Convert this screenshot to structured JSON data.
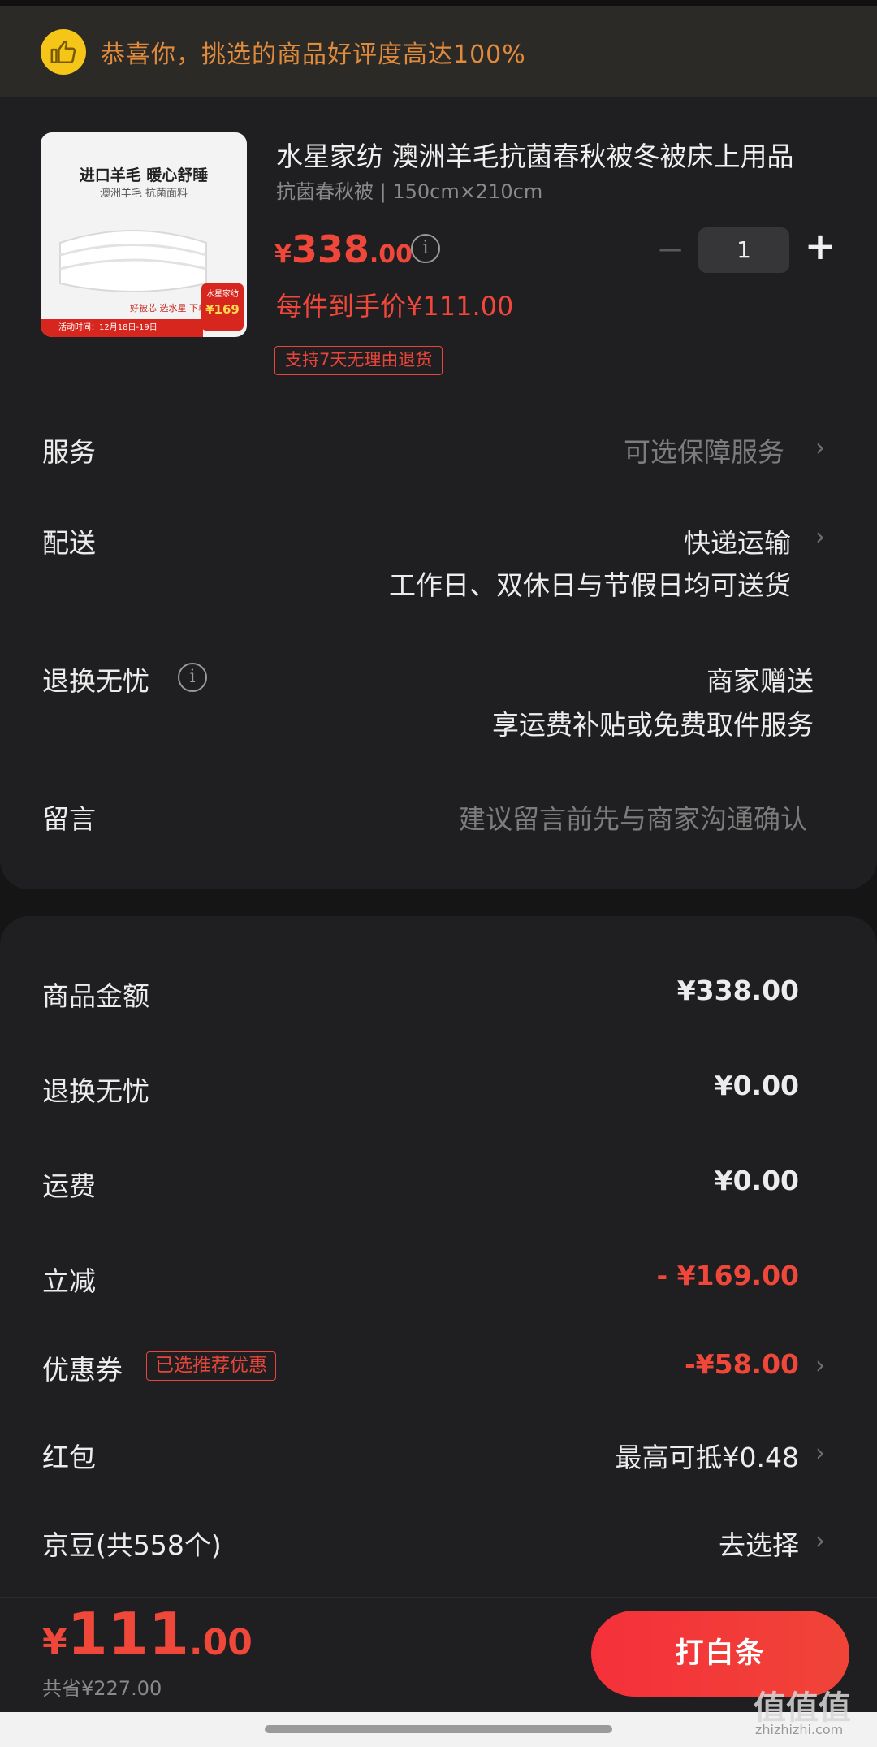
{
  "banner": {
    "text": "恭喜你，挑选的商品好评度高达100%",
    "icon": "thumbs-up-icon",
    "accent": "#f5c518"
  },
  "product": {
    "image": {
      "headline": "进口羊毛 暖心舒睡",
      "subline": "澳洲羊毛 抗菌面料",
      "badge_title": "水星家纺",
      "badge_price": "¥169",
      "stripe": "活动时间：12月18日-19日",
      "promo": "好被芯 选水星 下单立减"
    },
    "title": "水星家纺 澳洲羊毛抗菌春秋被冬被床上用品",
    "spec": "抗菌春秋被 | 150cm×210cm",
    "price": {
      "currency": "¥",
      "integer": "338",
      "decimal": ".00"
    },
    "quantity": "1",
    "unit_price_text": "每件到手价¥111.00",
    "return_tag": "支持7天无理由退货"
  },
  "rows": {
    "service": {
      "label": "服务",
      "value": "可选保障服务"
    },
    "delivery": {
      "label": "配送",
      "value": "快递运输",
      "sub": "工作日、双休日与节假日均可送货"
    },
    "return": {
      "label": "退换无忧",
      "value": "商家赠送",
      "sub": "享运费补贴或免费取件服务"
    },
    "note": {
      "label": "留言",
      "placeholder": "建议留言前先与商家沟通确认"
    }
  },
  "summary": {
    "goods": {
      "label": "商品金额",
      "value": "¥338.00"
    },
    "return": {
      "label": "退换无忧",
      "value": "¥0.00"
    },
    "shipping": {
      "label": "运费",
      "value": "¥0.00"
    },
    "discount": {
      "label": "立减",
      "value": "- ¥169.00"
    },
    "coupon": {
      "label": "优惠券",
      "tag": "已选推荐优惠",
      "value": "-¥58.00"
    },
    "redpacket": {
      "label": "红包",
      "value": "最高可抵¥0.48"
    },
    "jingdou": {
      "label": "京豆(共558个)",
      "value": "去选择"
    }
  },
  "footer": {
    "total": {
      "currency": "¥",
      "integer": "111",
      "decimal": ".00"
    },
    "saved": "共省¥227.00",
    "pay_button": "打白条",
    "watermark": "值值值",
    "watermark_sub": "zhizhizhi.com"
  },
  "colors": {
    "accent_red": "#f0473b",
    "background": "#151515",
    "card": "#1f1e20"
  }
}
